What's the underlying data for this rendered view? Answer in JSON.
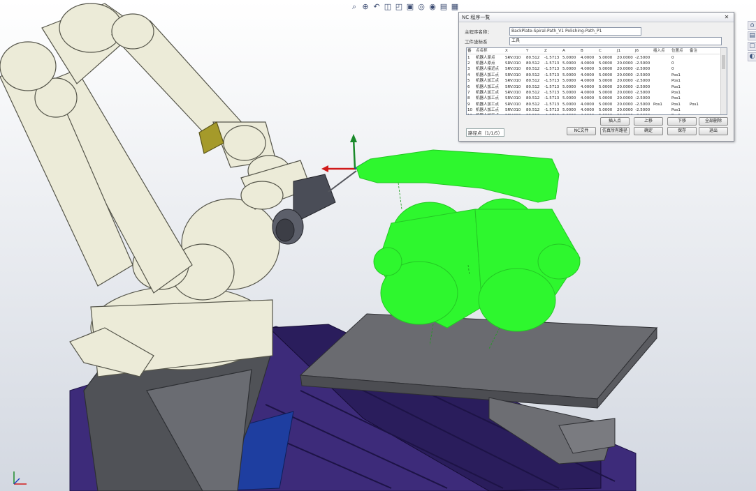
{
  "viewport": {
    "background_top": "#ffffff",
    "background_bottom": "#d3d8e1",
    "robot_color": "#ecebd8",
    "tool_color": "#5a5d66",
    "path_color": "#2ef72e",
    "table_color": "#6b6c70",
    "base_color": "#3f2a7a"
  },
  "view_toolbar": {
    "icons": [
      "zoom-fit-icon",
      "zoom-area-icon",
      "previous-view-icon",
      "section-view-icon",
      "view-orientation-icon",
      "display-style-icon",
      "hide-show-icon",
      "appearance-icon",
      "scene-icon",
      "view-settings-icon"
    ]
  },
  "task_pane": {
    "icons": [
      "resources-icon",
      "design-library-icon",
      "file-explorer-icon",
      "appearances-icon"
    ]
  },
  "dialog": {
    "title": "NC 程序一覧",
    "close_glyph": "✕",
    "program_label": "主程序名称：",
    "program_value": "BackPlate-Spiral-Path_V1 Polishing-Path_P1",
    "unit_label": "工件坐标系",
    "unit_value": "工具",
    "columns": [
      "番",
      "点名称",
      "X",
      "Y",
      "Z",
      "A",
      "B",
      "C",
      "J1",
      "J6",
      "插入点",
      "位置点",
      "备注"
    ],
    "rows": [
      [
        "1",
        "机器人原点",
        "SRV.010",
        "80.512",
        "-1.5713",
        "5.0000",
        "4.0000",
        "5.0000",
        "20.0000",
        "-2.5000",
        "",
        "0",
        ""
      ],
      [
        "2",
        "机器人原点",
        "SRV.010",
        "80.512",
        "-1.5713",
        "5.0000",
        "4.0000",
        "5.0000",
        "20.0000",
        "-2.5000",
        "",
        "0",
        ""
      ],
      [
        "3",
        "机器人接近点",
        "SRV.010",
        "80.512",
        "-1.5713",
        "5.0000",
        "4.0000",
        "5.0000",
        "20.0000",
        "-2.5000",
        "",
        "0",
        ""
      ],
      [
        "4",
        "机器人加工点",
        "SRV.010",
        "80.512",
        "-1.5713",
        "5.0000",
        "4.0000",
        "5.0000",
        "20.0000",
        "-2.5000",
        "",
        "Pos1",
        ""
      ],
      [
        "5",
        "机器人加工点",
        "SRV.010",
        "80.512",
        "-1.5713",
        "5.0000",
        "4.0000",
        "5.0000",
        "20.0000",
        "-2.5000",
        "",
        "Pos1",
        ""
      ],
      [
        "6",
        "机器人加工点",
        "SRV.010",
        "80.512",
        "-1.5713",
        "5.0000",
        "4.0000",
        "5.0000",
        "20.0000",
        "-2.5000",
        "",
        "Pos1",
        ""
      ],
      [
        "7",
        "机器人加工点",
        "SRV.010",
        "80.512",
        "-1.5713",
        "5.0000",
        "4.0000",
        "5.0000",
        "20.0000",
        "-2.5000",
        "",
        "Pos1",
        ""
      ],
      [
        "8",
        "机器人加工点",
        "SRV.010",
        "80.512",
        "-1.5713",
        "5.0000",
        "4.0000",
        "5.0000",
        "20.0000",
        "-2.5000",
        "",
        "Pos1",
        ""
      ],
      [
        "9",
        "机器人加工点",
        "SRV.010",
        "80.512",
        "-1.5713",
        "5.0000",
        "4.0000",
        "5.0000",
        "20.0000",
        "-2.5000",
        "Pos1",
        "Pos1",
        "Pos1"
      ],
      [
        "10",
        "机器人加工点",
        "SRV.010",
        "80.512",
        "-1.5713",
        "5.0000",
        "4.0000",
        "5.0000",
        "20.0000",
        "-2.5000",
        "",
        "Pos1",
        ""
      ],
      [
        "11",
        "机器人加工点",
        "SRV.010",
        "80.512",
        "-1.5713",
        "5.0000",
        "4.0000",
        "5.0000",
        "20.0000",
        "-2.5000",
        "",
        "Pos1",
        ""
      ]
    ],
    "footer_left": "路径点（1/1/5）",
    "buttons_row1": [
      "插入点",
      "上移",
      "下移",
      "全部删除"
    ],
    "buttons_row2": [
      "NC文件",
      "仿真所有路径",
      "确定",
      "保存",
      "退出"
    ]
  }
}
